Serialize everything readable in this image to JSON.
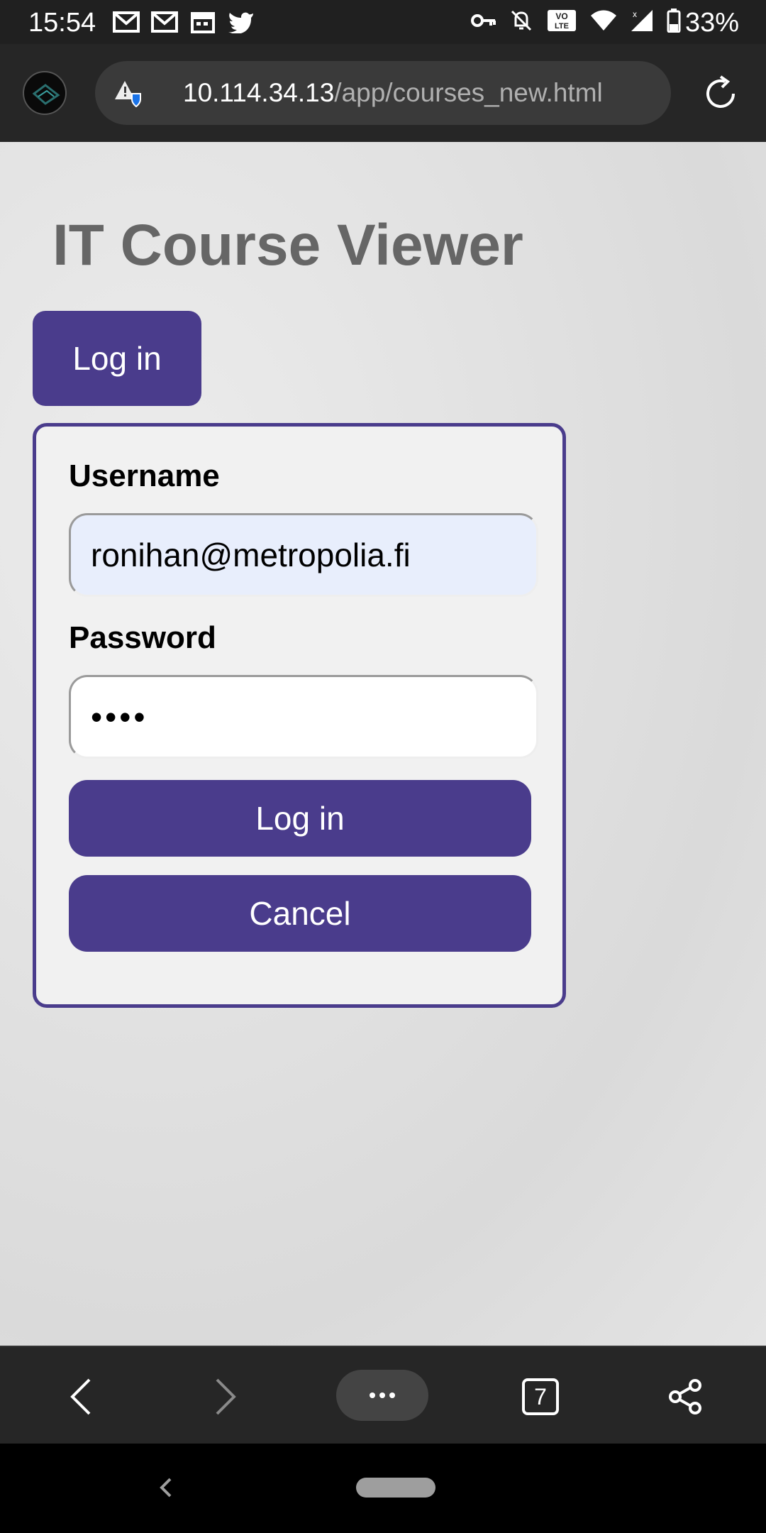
{
  "status_bar": {
    "time": "15:54",
    "left_icons": [
      "gmail-icon",
      "gmail-icon",
      "calendar-icon",
      "twitter-icon"
    ],
    "right_icons": [
      "vpn-key-icon",
      "bell-off-icon",
      "volte-icon",
      "wifi-icon",
      "signal-icon",
      "battery-icon"
    ],
    "battery": "33%"
  },
  "browser": {
    "url_host": "10.114.34.13",
    "url_path": "/app/courses_new.html",
    "tab_count": "7"
  },
  "page": {
    "title": "IT Course Viewer",
    "header_login_label": "Log in",
    "login_form": {
      "username_label": "Username",
      "username_value": "ronihan@metropolia.fi",
      "password_label": "Password",
      "password_value": "••••",
      "login_button": "Log in",
      "cancel_button": "Cancel"
    }
  },
  "colors": {
    "accent": "#4a3c8c",
    "autofill_bg": "#e8eefc"
  }
}
